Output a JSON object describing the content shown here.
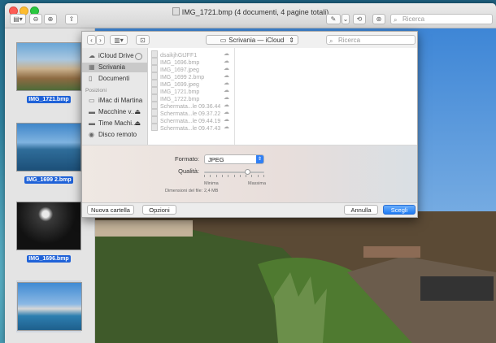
{
  "window": {
    "title": "IMG_1721.bmp (4 documenti, 4 pagine totali)",
    "search_placeholder": "Ricerca"
  },
  "thumbnails": [
    {
      "label": "IMG_1721.bmp"
    },
    {
      "label": "IMG_1699 2.bmp"
    },
    {
      "label": "IMG_1696.bmp"
    },
    {
      "label": ""
    }
  ],
  "dialog": {
    "location": "Scrivania — iCloud",
    "search_placeholder": "Ricerca",
    "sidebar": {
      "items_top": [
        {
          "label": "iCloud Drive",
          "icon": "cloud-icon"
        },
        {
          "label": "Scrivania",
          "icon": "desktop-folder-icon",
          "selected": true
        },
        {
          "label": "Documenti",
          "icon": "documents-icon"
        }
      ],
      "section_label": "Posizioni",
      "items_places": [
        {
          "label": "iMac di Martina",
          "icon": "imac-icon"
        },
        {
          "label": "Macchine v...",
          "icon": "disk-icon"
        },
        {
          "label": "Time Machi...",
          "icon": "timemachine-icon"
        },
        {
          "label": "Disco remoto",
          "icon": "remote-disk-icon"
        }
      ]
    },
    "files": [
      "dsaikjhGtJFF1",
      "IMG_1696.bmp",
      "IMG_1697.jpeg",
      "IMG_1699 2.bmp",
      "IMG_1699.jpeg",
      "IMG_1721.bmp",
      "IMG_1722.bmp",
      "Schermata...le 09.36.44",
      "Schermata...le 09.37.22",
      "Schermata...le 09.44.19",
      "Schermata...le 09.47.43"
    ],
    "format_label": "Formato:",
    "format_value": "JPEG",
    "quality_label": "Qualità:",
    "quality_min": "Minima",
    "quality_max": "Massima",
    "quality_level": 0.72,
    "filesize_label": "Dimensioni del file:",
    "filesize_value": "2,4 MB",
    "new_folder_button": "Nuova cartella",
    "options_button": "Opzioni",
    "cancel_button": "Annulla",
    "choose_button": "Scegli"
  }
}
